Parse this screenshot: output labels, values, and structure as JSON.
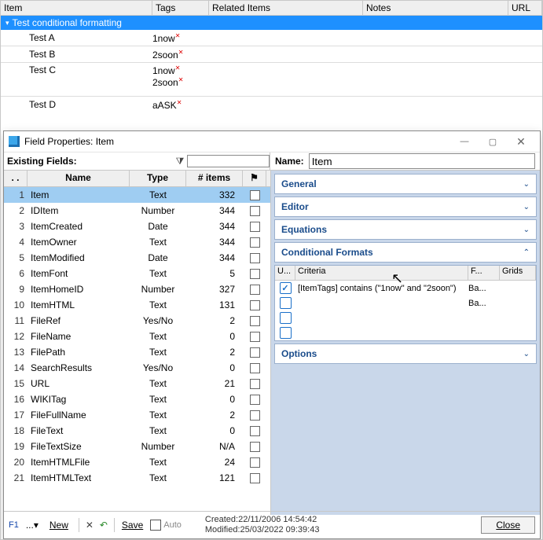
{
  "bgGrid": {
    "columns": [
      "Item",
      "Tags",
      "Related Items",
      "Notes",
      "URL"
    ],
    "groupRow": "Test conditional formatting",
    "rows": [
      {
        "item": "Test A",
        "tags": [
          {
            "t": "1now",
            "x": true
          }
        ]
      },
      {
        "item": "Test B",
        "tags": [
          {
            "t": "2soon",
            "x": true
          }
        ]
      },
      {
        "item": "Test C",
        "tags": [
          {
            "t": "1now",
            "x": true
          },
          {
            "t": "2soon",
            "x": true
          }
        ]
      },
      {
        "item": "Test D",
        "tags": [
          {
            "t": "aASK",
            "x": true
          }
        ]
      }
    ]
  },
  "dialog": {
    "title": "Field Properties: Item",
    "existingFieldsLabel": "Existing Fields:",
    "filterValue": "",
    "nameLabel": "Name:",
    "nameValue": "Item",
    "gridHeaders": {
      "dots": ". .",
      "name": "Name",
      "type": "Type",
      "items": "# items",
      "flag": "⚑"
    },
    "rows": [
      {
        "n": 1,
        "name": "Item",
        "type": "Text",
        "items": "332",
        "sel": true
      },
      {
        "n": 2,
        "name": "IDItem",
        "type": "Number",
        "items": "344"
      },
      {
        "n": 3,
        "name": "ItemCreated",
        "type": "Date",
        "items": "344"
      },
      {
        "n": 4,
        "name": "ItemOwner",
        "type": "Text",
        "items": "344"
      },
      {
        "n": 5,
        "name": "ItemModified",
        "type": "Date",
        "items": "344"
      },
      {
        "n": 6,
        "name": "ItemFont",
        "type": "Text",
        "items": "5"
      },
      {
        "n": 9,
        "name": "ItemHomeID",
        "type": "Number",
        "items": "327"
      },
      {
        "n": 10,
        "name": "ItemHTML",
        "type": "Text",
        "items": "131"
      },
      {
        "n": 11,
        "name": "FileRef",
        "type": "Yes/No",
        "items": "2"
      },
      {
        "n": 12,
        "name": "FileName",
        "type": "Text",
        "items": "0"
      },
      {
        "n": 13,
        "name": "FilePath",
        "type": "Text",
        "items": "2"
      },
      {
        "n": 14,
        "name": "SearchResults",
        "type": "Yes/No",
        "items": "0"
      },
      {
        "n": 15,
        "name": "URL",
        "type": "Text",
        "items": "21"
      },
      {
        "n": 16,
        "name": "WIKITag",
        "type": "Text",
        "items": "0"
      },
      {
        "n": 17,
        "name": "FileFullName",
        "type": "Text",
        "items": "2"
      },
      {
        "n": 18,
        "name": "FileText",
        "type": "Text",
        "items": "0"
      },
      {
        "n": 19,
        "name": "FileTextSize",
        "type": "Number",
        "items": "N/A"
      },
      {
        "n": 20,
        "name": "ItemHTMLFile",
        "type": "Text",
        "items": "24"
      },
      {
        "n": 21,
        "name": "ItemHTMLText",
        "type": "Text",
        "items": "121"
      }
    ],
    "sections": {
      "general": "General",
      "editor": "Editor",
      "equations": "Equations",
      "conditional": "Conditional Formats",
      "options": "Options"
    },
    "cf": {
      "headers": {
        "use": "U...",
        "criteria": "Criteria",
        "f": "F...",
        "grids": "Grids"
      },
      "rows": [
        {
          "use": true,
          "criteria": "[ItemTags] contains (\"1now\" and \"2soon\")",
          "f": "Ba..."
        },
        {
          "use": false,
          "criteria": "",
          "f": "Ba..."
        },
        {
          "use": false,
          "criteria": "",
          "f": ""
        },
        {
          "use": false,
          "criteria": "",
          "f": ""
        }
      ]
    }
  },
  "footer": {
    "f1": "F1",
    "new": "New",
    "save": "Save",
    "auto": "Auto",
    "created": "Created:22/11/2006 14:54:42",
    "modified": "Modified:25/03/2022 09:39:43",
    "close": "Close"
  }
}
